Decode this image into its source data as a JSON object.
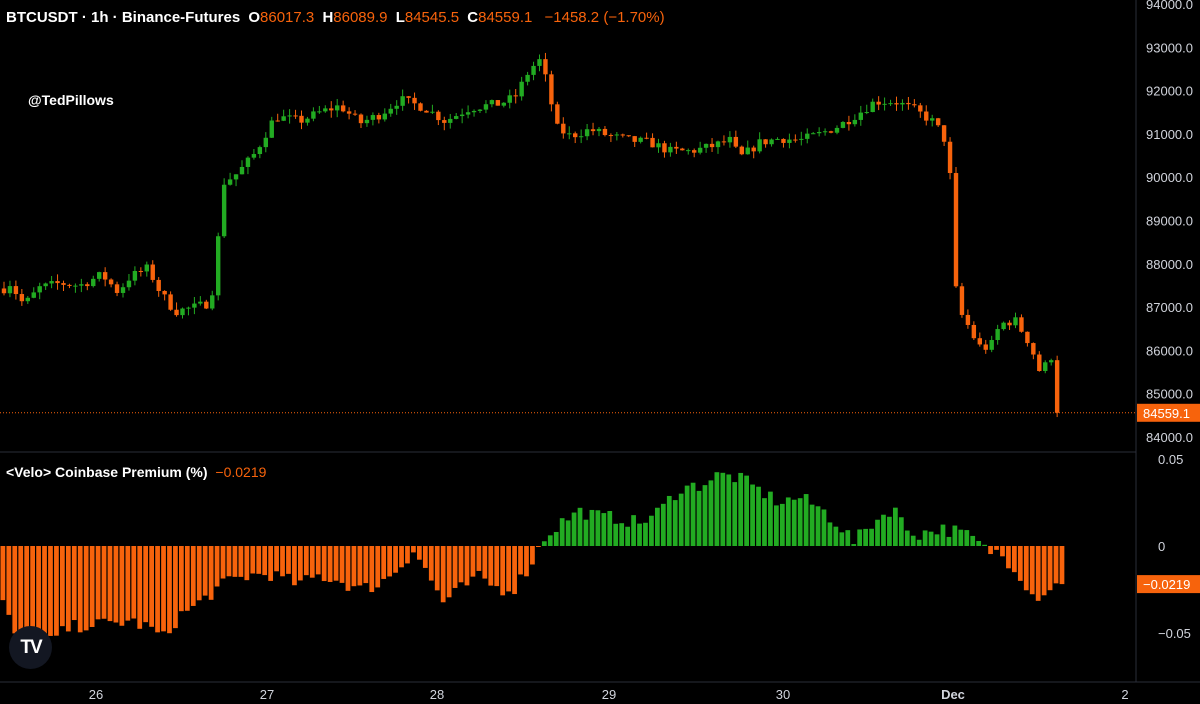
{
  "header": {
    "symbol": "BTCUSDT · 1h · Binance-Futures",
    "open_label": "O",
    "open": "86017.3",
    "high_label": "H",
    "high": "86089.9",
    "low_label": "L",
    "low": "84545.5",
    "close_label": "C",
    "close": "84559.1",
    "change": "−1458.2 (−1.70%)"
  },
  "watermark_handle": "@TedPillows",
  "indicator": {
    "name": "<Velo> Coinbase Premium (%)",
    "value": "−0.0219"
  },
  "logo_text": "TV",
  "colors": {
    "up": "#22ab22",
    "down": "#f7630c",
    "background": "#000000",
    "axis_text": "#d1d4dc",
    "grid_line": "#2a2e39"
  },
  "chart_data": [
    {
      "type": "candlestick",
      "series_name": "BTCUSDT · 1h · Binance-Futures",
      "y_ticks": [
        84000,
        85000,
        86000,
        87000,
        88000,
        89000,
        90000,
        91000,
        92000,
        93000,
        94000
      ],
      "y_tick_labels": [
        "84000.0",
        "85000.0",
        "86000.0",
        "87000.0",
        "88000.0",
        "89000.0",
        "90000.0",
        "91000.0",
        "92000.0",
        "93000.0",
        "94000.0"
      ],
      "ylim": [
        83750,
        94150
      ],
      "last_price": 84559.1,
      "last_price_label": "84559.1",
      "waypoints": [
        [
          0,
          87350
        ],
        [
          10,
          87550
        ],
        [
          24,
          87050
        ],
        [
          40,
          87450
        ],
        [
          60,
          87550
        ],
        [
          80,
          87500
        ],
        [
          102,
          87750
        ],
        [
          118,
          87350
        ],
        [
          130,
          87700
        ],
        [
          148,
          87900
        ],
        [
          160,
          87350
        ],
        [
          175,
          86900
        ],
        [
          195,
          87000
        ],
        [
          210,
          87100
        ],
        [
          216,
          87850
        ],
        [
          222,
          89850
        ],
        [
          238,
          90100
        ],
        [
          255,
          90550
        ],
        [
          275,
          91400
        ],
        [
          300,
          91300
        ],
        [
          320,
          91500
        ],
        [
          340,
          91650
        ],
        [
          360,
          91250
        ],
        [
          380,
          91450
        ],
        [
          400,
          91800
        ],
        [
          425,
          91600
        ],
        [
          445,
          91300
        ],
        [
          470,
          91600
        ],
        [
          500,
          91700
        ],
        [
          515,
          91850
        ],
        [
          530,
          92500
        ],
        [
          540,
          92700
        ],
        [
          548,
          92100
        ],
        [
          556,
          91150
        ],
        [
          570,
          90950
        ],
        [
          590,
          91100
        ],
        [
          610,
          90950
        ],
        [
          630,
          90850
        ],
        [
          650,
          90800
        ],
        [
          670,
          90600
        ],
        [
          690,
          90600
        ],
        [
          710,
          90700
        ],
        [
          730,
          90850
        ],
        [
          740,
          90450
        ],
        [
          760,
          90800
        ],
        [
          780,
          90900
        ],
        [
          800,
          90850
        ],
        [
          820,
          91000
        ],
        [
          840,
          91200
        ],
        [
          860,
          91500
        ],
        [
          875,
          91750
        ],
        [
          895,
          91750
        ],
        [
          915,
          91550
        ],
        [
          935,
          91250
        ],
        [
          944,
          90900
        ],
        [
          950,
          90050
        ],
        [
          956,
          87400
        ],
        [
          962,
          86800
        ],
        [
          970,
          86500
        ],
        [
          978,
          86100
        ],
        [
          990,
          86050
        ],
        [
          1000,
          86600
        ],
        [
          1015,
          86700
        ],
        [
          1030,
          86150
        ],
        [
          1040,
          85500
        ],
        [
          1047,
          85700
        ],
        [
          1055,
          86000
        ],
        [
          1061,
          84560
        ]
      ]
    },
    {
      "type": "bar",
      "series_name": "<Velo> Coinbase Premium (%)",
      "y_ticks": [
        0.05,
        0,
        -0.05
      ],
      "y_tick_labels": [
        "0.05",
        "0",
        "−0.05"
      ],
      "ylim": [
        -0.075,
        0.055
      ],
      "last_value": -0.0219,
      "last_value_label": "−0.0219",
      "waypoints": [
        [
          0,
          -0.028
        ],
        [
          15,
          -0.05
        ],
        [
          40,
          -0.06
        ],
        [
          55,
          -0.053
        ],
        [
          70,
          -0.047
        ],
        [
          90,
          -0.045
        ],
        [
          110,
          -0.045
        ],
        [
          130,
          -0.043
        ],
        [
          150,
          -0.047
        ],
        [
          165,
          -0.053
        ],
        [
          180,
          -0.04
        ],
        [
          195,
          -0.035
        ],
        [
          210,
          -0.028
        ],
        [
          230,
          -0.02
        ],
        [
          250,
          -0.017
        ],
        [
          270,
          -0.016
        ],
        [
          300,
          -0.022
        ],
        [
          320,
          -0.017
        ],
        [
          340,
          -0.02
        ],
        [
          360,
          -0.025
        ],
        [
          380,
          -0.022
        ],
        [
          400,
          -0.012
        ],
        [
          415,
          -0.002
        ],
        [
          430,
          -0.018
        ],
        [
          445,
          -0.033
        ],
        [
          460,
          -0.025
        ],
        [
          480,
          -0.018
        ],
        [
          500,
          -0.025
        ],
        [
          515,
          -0.024
        ],
        [
          530,
          -0.012
        ],
        [
          545,
          0.005
        ],
        [
          565,
          0.015
        ],
        [
          580,
          0.02
        ],
        [
          600,
          0.017
        ],
        [
          620,
          0.016
        ],
        [
          640,
          0.013
        ],
        [
          660,
          0.02
        ],
        [
          680,
          0.033
        ],
        [
          700,
          0.035
        ],
        [
          720,
          0.041
        ],
        [
          740,
          0.039
        ],
        [
          760,
          0.032
        ],
        [
          780,
          0.025
        ],
        [
          800,
          0.028
        ],
        [
          820,
          0.022
        ],
        [
          840,
          0.012
        ],
        [
          855,
          0.002
        ],
        [
          870,
          0.012
        ],
        [
          880,
          0.016
        ],
        [
          895,
          0.023
        ],
        [
          905,
          0.01
        ],
        [
          920,
          0.007
        ],
        [
          940,
          0.01
        ],
        [
          960,
          0.008
        ],
        [
          975,
          0.004
        ],
        [
          985,
          -0.002
        ],
        [
          1000,
          -0.004
        ],
        [
          1015,
          -0.012
        ],
        [
          1025,
          -0.02
        ],
        [
          1035,
          -0.03
        ],
        [
          1045,
          -0.026
        ],
        [
          1055,
          -0.023
        ],
        [
          1061,
          -0.0219
        ]
      ]
    }
  ],
  "x_axis": {
    "tick_labels": [
      "26",
      "27",
      "28",
      "29",
      "30",
      "Dec",
      "2"
    ]
  }
}
